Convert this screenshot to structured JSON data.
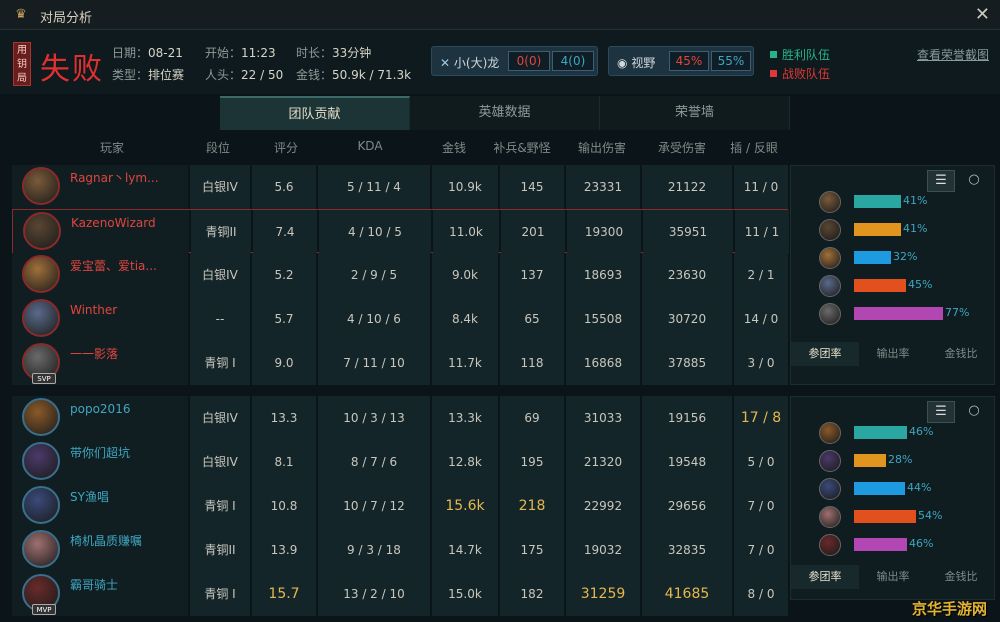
{
  "window": {
    "title": "对局分析",
    "close": "✕"
  },
  "summary": {
    "mode_badge": "用钥局",
    "result": "失败",
    "date_label": "日期：",
    "date": "08-21",
    "type_label": "类型：",
    "type": "排位赛",
    "start_label": "开始：",
    "start": "11:23",
    "players_label": "人头：",
    "players": "22 / 50",
    "duration_label": "时长：",
    "duration": "33分钟",
    "money_label": "金钱：",
    "money": "50.9k / 71.3k",
    "dragon": {
      "label": "小(大)龙",
      "left": "0(0)",
      "right": "4(0)"
    },
    "vision": {
      "label": "视野",
      "left": "45%",
      "right": "55%"
    },
    "legend_win": "胜利队伍",
    "legend_lose": "战败队伍",
    "honor_link": "查看荣誉截图"
  },
  "tabs": [
    "团队贡献",
    "英雄数据",
    "荣誉墙"
  ],
  "columns": [
    "玩家",
    "段位",
    "评分",
    "KDA",
    "金钱",
    "补兵&野怪",
    "输出伤害",
    "承受伤害",
    "插 / 反眼"
  ],
  "team1": [
    {
      "name": "Ragnar丶lym...",
      "rank": "白银IV",
      "score": "5.6",
      "kda": "5 / 11 / 4",
      "gold": "10.9k",
      "cs": "145",
      "dmg": "23331",
      "taken": "21122",
      "wards": "11 / 0"
    },
    {
      "name": "KazenoWizard",
      "rank": "青铜II",
      "score": "7.4",
      "kda": "4 / 10 / 5",
      "gold": "11.0k",
      "cs": "201",
      "dmg": "19300",
      "taken": "35951",
      "wards": "11 / 1"
    },
    {
      "name": "爱宝蕾、爱tia...",
      "rank": "白银IV",
      "score": "5.2",
      "kda": "2 / 9 / 5",
      "gold": "9.0k",
      "cs": "137",
      "dmg": "18693",
      "taken": "23630",
      "wards": "2 / 1"
    },
    {
      "name": "Winther",
      "rank": "--",
      "score": "5.7",
      "kda": "4 / 10 / 6",
      "gold": "8.4k",
      "cs": "65",
      "dmg": "15508",
      "taken": "30720",
      "wards": "14 / 0"
    },
    {
      "name": "一一影落",
      "rank": "青铜 I",
      "score": "9.0",
      "kda": "7 / 11 / 10",
      "gold": "11.7k",
      "cs": "118",
      "dmg": "16868",
      "taken": "37885",
      "wards": "3 / 0",
      "badge": "SVP"
    }
  ],
  "team2": [
    {
      "name": "popo2016",
      "rank": "白银IV",
      "score": "13.3",
      "kda": "10 / 3 / 13",
      "gold": "13.3k",
      "cs": "69",
      "dmg": "31033",
      "taken": "19156",
      "wards": "17 / 8"
    },
    {
      "name": "带你们超坑",
      "rank": "白银IV",
      "score": "8.1",
      "kda": "8 / 7 / 6",
      "gold": "12.8k",
      "cs": "195",
      "dmg": "21320",
      "taken": "19548",
      "wards": "5 / 0"
    },
    {
      "name": "SY渔唱",
      "rank": "青铜 I",
      "score": "10.8",
      "kda": "10 / 7 / 12",
      "gold": "15.6k",
      "cs": "218",
      "dmg": "22992",
      "taken": "29656",
      "wards": "7 / 0"
    },
    {
      "name": "椅机晶质赚嘱",
      "rank": "青铜II",
      "score": "13.9",
      "kda": "9 / 3 / 18",
      "gold": "14.7k",
      "cs": "175",
      "dmg": "19032",
      "taken": "32835",
      "wards": "7 / 0"
    },
    {
      "name": "霸哥骑士",
      "rank": "青铜 I",
      "score": "15.7",
      "kda": "13 / 2 / 10",
      "gold": "15.0k",
      "cs": "182",
      "dmg": "31259",
      "taken": "41685",
      "wards": "8 / 0",
      "badge": "MVP"
    }
  ],
  "panel1": {
    "values": [
      "41%",
      "41%",
      "32%",
      "45%",
      "77%"
    ],
    "fractions": [
      0.41,
      0.41,
      0.32,
      0.45,
      0.77
    ]
  },
  "panel2": {
    "values": [
      "46%",
      "28%",
      "44%",
      "54%",
      "46%"
    ],
    "fractions": [
      0.46,
      0.28,
      0.44,
      0.54,
      0.46
    ]
  },
  "panel_tabs": [
    "参团率",
    "输出率",
    "金钱比"
  ],
  "colors": {
    "bar1": "#2aa7a1",
    "bar2": "#e2951e",
    "bar3": "#1e9be0",
    "bar4": "#e2501e",
    "bar5": "#b247b4",
    "lose": "#e03838",
    "win": "#25b38a"
  },
  "watermark": "京华手游网"
}
